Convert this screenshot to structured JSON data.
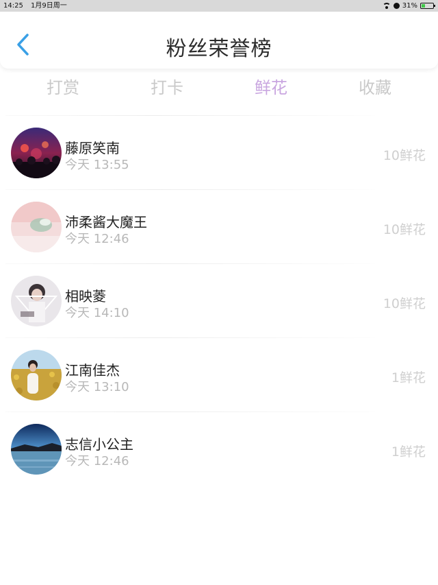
{
  "status_bar": {
    "time": "14:25",
    "date": "1月9日周一",
    "battery": "31%",
    "battery_level": 0.31,
    "battery_color": "#41c94a"
  },
  "header": {
    "title": "粉丝荣誉榜",
    "back_icon": "chevron-left-icon",
    "back_color": "#3aa0e6"
  },
  "tabs": [
    {
      "label": "打赏",
      "active": false
    },
    {
      "label": "打卡",
      "active": false
    },
    {
      "label": "鲜花",
      "active": true
    },
    {
      "label": "收藏",
      "active": false
    }
  ],
  "colors": {
    "active_tab": "#c9a6e0",
    "inactive_tab": "#c9c9c9"
  },
  "fans": [
    {
      "name": "藤原笑南",
      "time": "今天 13:55",
      "count": "10鲜花",
      "avatar": "concert-crowd-avatar"
    },
    {
      "name": "沛柔酱大魔王",
      "time": "今天 12:46",
      "count": "10鲜花",
      "avatar": "pink-illustration-avatar"
    },
    {
      "name": "相映菱",
      "time": "今天 14:10",
      "count": "10鲜花",
      "avatar": "portrait-avatar"
    },
    {
      "name": "江南佳杰",
      "time": "今天 13:10",
      "count": "1鲜花",
      "avatar": "flower-field-avatar"
    },
    {
      "name": "志信小公主",
      "time": "今天 12:46",
      "count": "1鲜花",
      "avatar": "lake-landscape-avatar"
    }
  ]
}
